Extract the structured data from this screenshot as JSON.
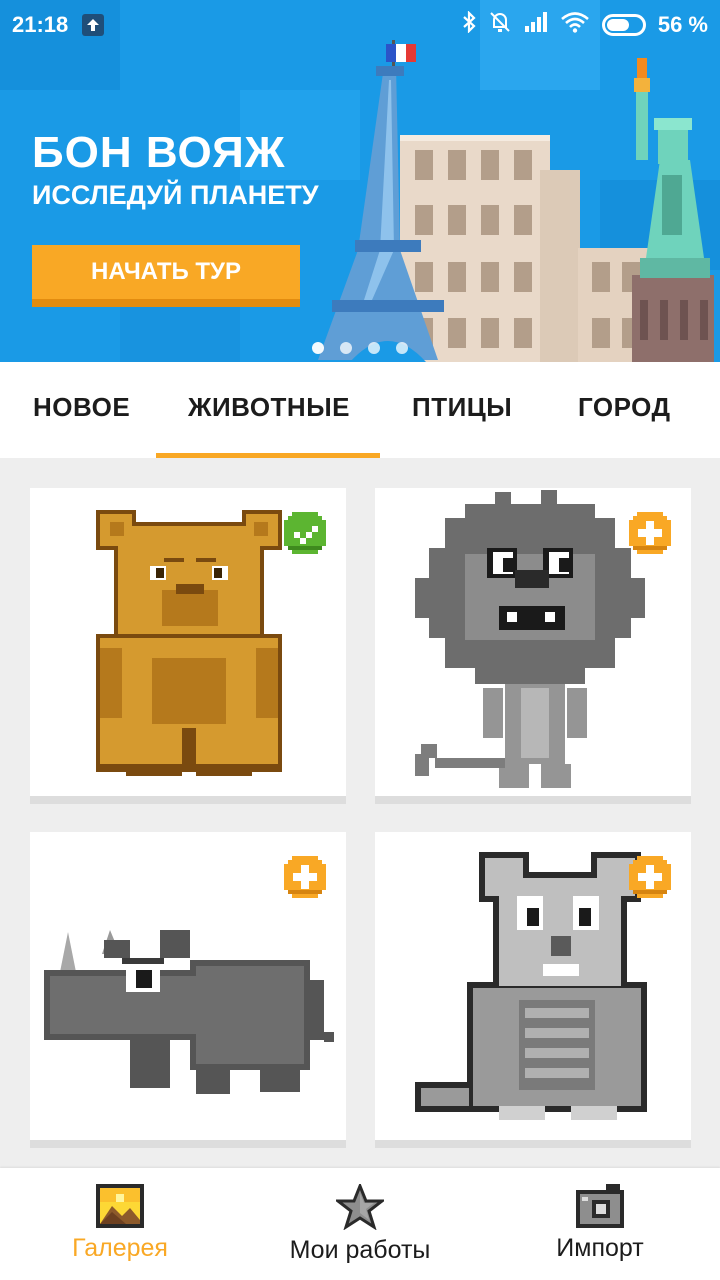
{
  "status_bar": {
    "time": "21:18",
    "battery": "56 %"
  },
  "banner": {
    "title": "БОН ВОЯЖ",
    "subtitle": "ИССЛЕДУЙ ПЛАНЕТУ",
    "button_label": "НАЧАТЬ ТУР",
    "slide_count": 4,
    "active_slide": 1
  },
  "tabs": [
    {
      "label": "НОВОЕ"
    },
    {
      "label": "ЖИВОТНЫЕ",
      "active": true
    },
    {
      "label": "ПТИЦЫ"
    },
    {
      "label": "ГОРОД"
    }
  ],
  "gallery": [
    {
      "subject": "bear",
      "status": "completed",
      "badge_icon": "check-badge-icon",
      "colored": true
    },
    {
      "subject": "lion",
      "status": "new",
      "badge_icon": "plus-badge-icon",
      "colored": false
    },
    {
      "subject": "rhino",
      "status": "new",
      "badge_icon": "plus-badge-icon",
      "colored": false
    },
    {
      "subject": "mouse",
      "status": "new",
      "badge_icon": "plus-badge-icon",
      "colored": false
    }
  ],
  "bottom_nav": [
    {
      "label": "Галерея",
      "icon": "gallery-icon",
      "active": true
    },
    {
      "label": "Мои работы",
      "icon": "star-icon",
      "active": false
    },
    {
      "label": "Импорт",
      "icon": "camera-icon",
      "active": false
    }
  ],
  "colors": {
    "accent": "#f9a825",
    "banner_blue": "#1a9ae6",
    "done_green": "#5cb531"
  }
}
